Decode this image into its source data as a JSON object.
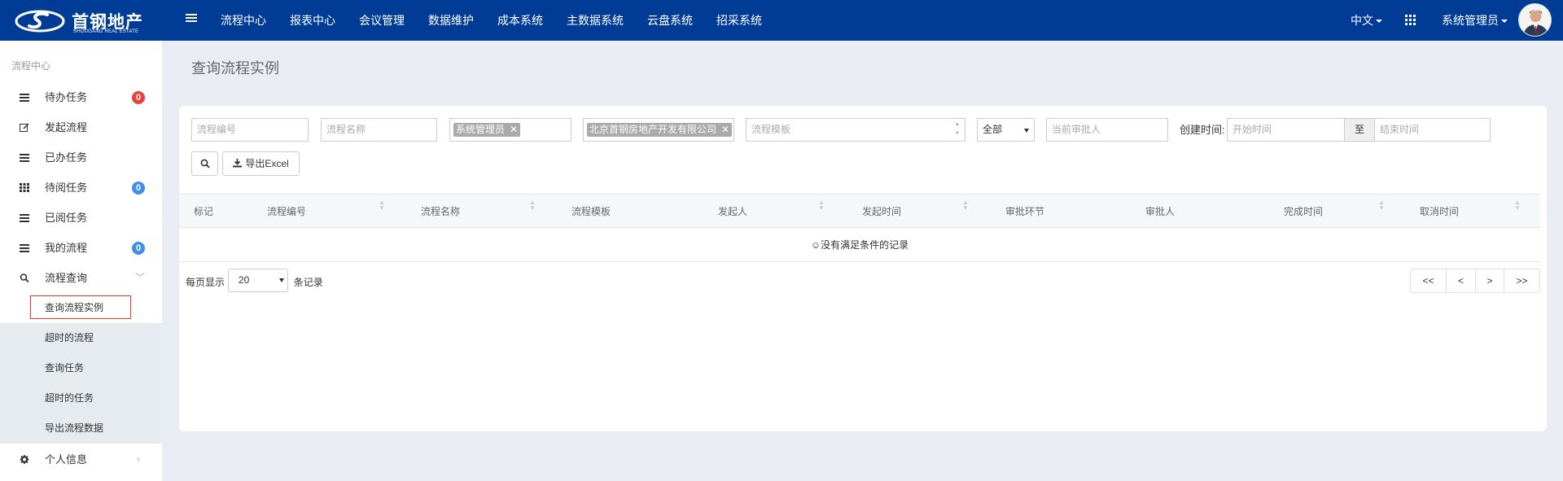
{
  "brand": {
    "name": "首钢地产",
    "subtitle": "SHOUGANG REAL ESTATE"
  },
  "nav": [
    "流程中心",
    "报表中心",
    "会议管理",
    "数据维护",
    "成本系统",
    "主数据系统",
    "云盘系统",
    "招采系统"
  ],
  "topright": {
    "language": "中文",
    "user": "系统管理员"
  },
  "sidebar": {
    "title": "流程中心",
    "items": [
      {
        "label": "待办任务",
        "icon": "list-icon",
        "badge": "0",
        "badge_color": "#e9413c"
      },
      {
        "label": "发起流程",
        "icon": "edit-icon"
      },
      {
        "label": "已办任务",
        "icon": "list-icon"
      },
      {
        "label": "待阅任务",
        "icon": "grid-icon",
        "badge": "0",
        "badge_color": "#3f8fe5"
      },
      {
        "label": "已阅任务",
        "icon": "list-icon"
      },
      {
        "label": "我的流程",
        "icon": "list-icon",
        "badge": "0",
        "badge_color": "#3f8fe5"
      },
      {
        "label": "流程查询",
        "icon": "search-icon"
      }
    ],
    "submenu": [
      "查询流程实例",
      "超时的流程",
      "查询任务",
      "超时的任务",
      "导出流程数据"
    ],
    "footer_item": {
      "label": "个人信息",
      "icon": "gear-icon"
    }
  },
  "page_title": "查询流程实例",
  "filters": {
    "process_no_placeholder": "流程编号",
    "process_name_placeholder": "流程名称",
    "initiator_tag": "系统管理员",
    "company_tag": "北京首钢房地产开发有限公司",
    "template_placeholder": "流程模板",
    "status_value": "全部",
    "approver_placeholder": "当前审批人",
    "created_label": "创建时间:",
    "start_placeholder": "开始时间",
    "to_label": "至",
    "end_placeholder": "结束时间",
    "export_label": "导出Excel"
  },
  "table": {
    "columns": [
      "标记",
      "流程编号",
      "流程名称",
      "流程模板",
      "发起人",
      "发起时间",
      "审批环节",
      "审批人",
      "完成时间",
      "取消时间"
    ],
    "empty_text": "☺没有满足条件的记录"
  },
  "pagination": {
    "per_page_label": "每页显示",
    "page_size": "20",
    "records_label": "条记录",
    "buttons": [
      "<<",
      "<",
      ">",
      ">>"
    ]
  }
}
